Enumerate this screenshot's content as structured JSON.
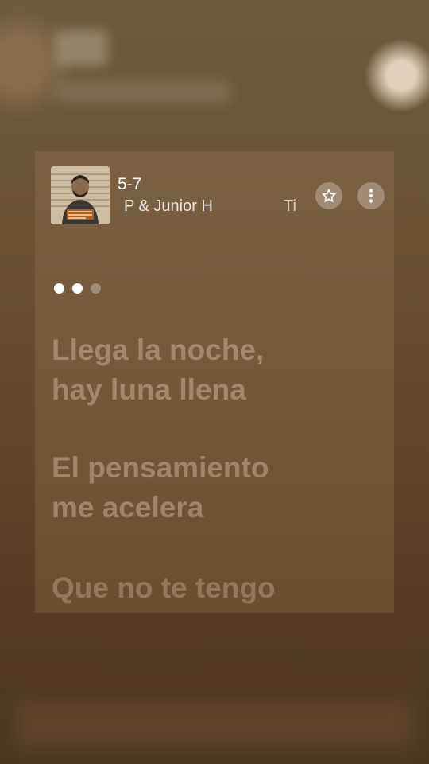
{
  "now_playing": {
    "title": "5-7",
    "artist": "P & Junior H",
    "extra_text": "Ti",
    "album_art_icon": "album-cover-mugshot"
  },
  "controls": {
    "favorite_icon": "star-icon",
    "more_icon": "more-vertical-icon"
  },
  "pager": {
    "total_dots": 3,
    "active_dots": 2
  },
  "lyrics": [
    "Llega la noche,",
    "hay luna llena",
    "El pensamiento",
    "me acelera",
    "Que no te tengo"
  ],
  "colors": {
    "card_background": "#7a5e40",
    "lyric_text": "#e1cdb4",
    "title_text": "#ffffff"
  }
}
